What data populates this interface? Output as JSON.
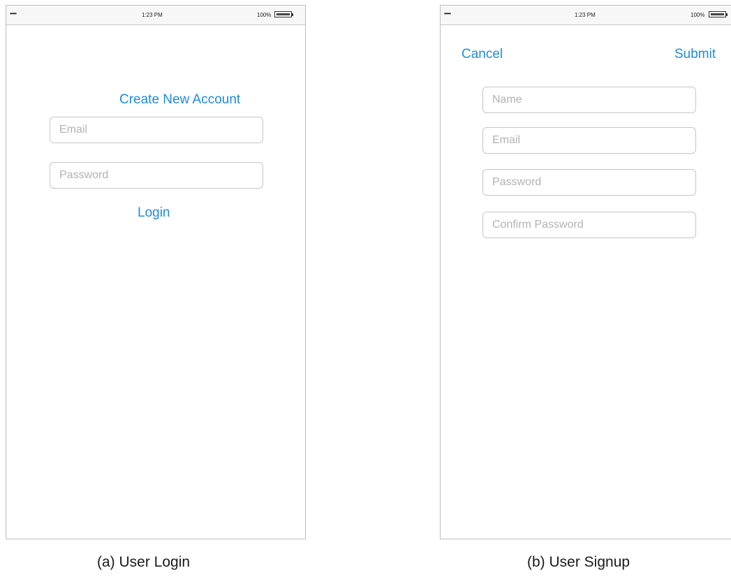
{
  "login_screen": {
    "status_bar": {
      "signal": "•••••",
      "time": "1:23 PM",
      "battery": "100%"
    },
    "create_account_label": "Create New Account",
    "email_placeholder": "Email",
    "password_placeholder": "Password",
    "login_label": "Login",
    "caption": "(a) User Login"
  },
  "signup_screen": {
    "status_bar": {
      "signal": "•••••",
      "time": "1:23 PM",
      "battery": "100%"
    },
    "cancel_label": "Cancel",
    "submit_label": "Submit",
    "name_placeholder": "Name",
    "email_placeholder": "Email",
    "password_placeholder": "Password",
    "confirm_password_placeholder": "Confirm Password",
    "caption": "(b) User Signup"
  },
  "colors": {
    "accent": "#1c8ce6",
    "placeholder": "#b2b2b2",
    "border": "#c6c6c6",
    "status_bar_bg": "#f7f7f7"
  },
  "icons": [
    "signal-dots-icon",
    "battery-icon"
  ]
}
